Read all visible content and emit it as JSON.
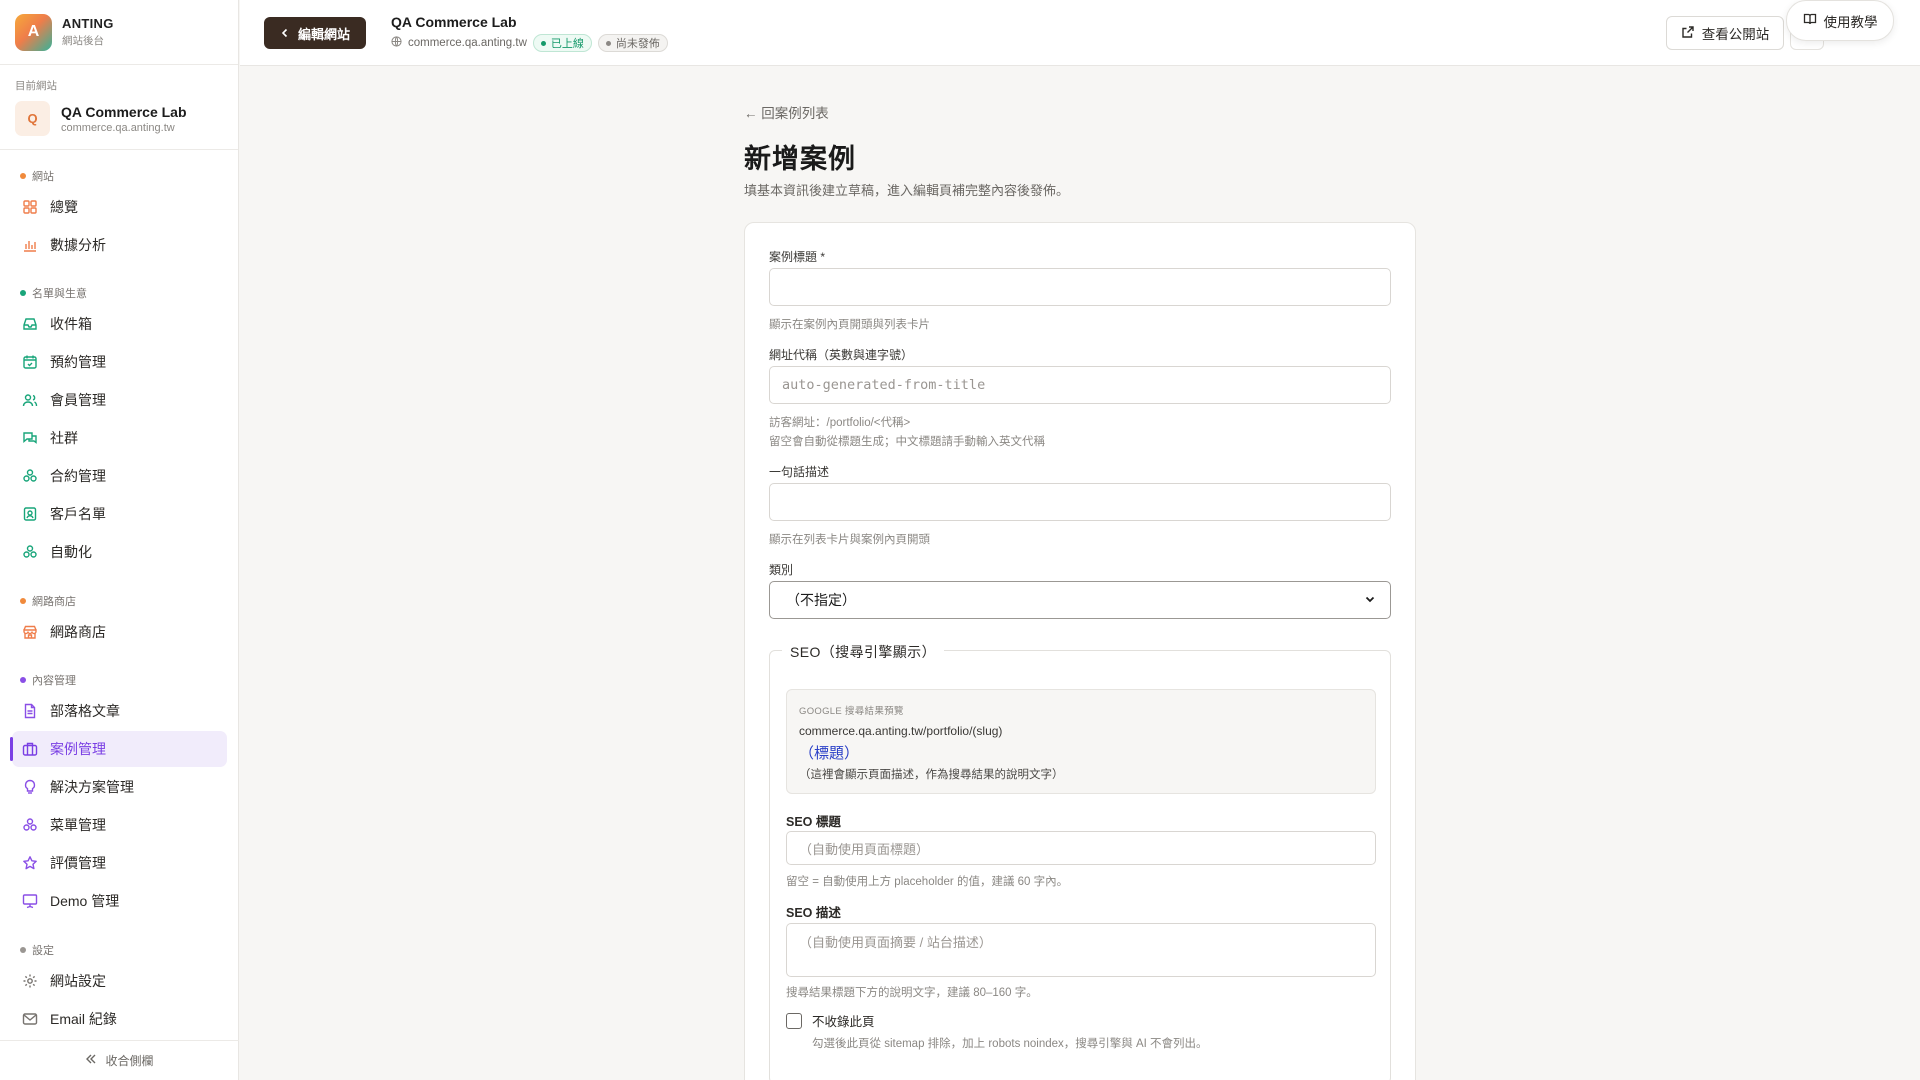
{
  "brand": {
    "logo_letter": "A",
    "name": "ANTING",
    "subtitle": "網站後台"
  },
  "current_site": {
    "caption": "目前網站",
    "avatar_letter": "Q",
    "name": "QA Commerce Lab",
    "domain": "commerce.qa.anting.tw"
  },
  "sidebar": {
    "sections": [
      {
        "title": "網站",
        "color": "#f08a3c"
      },
      {
        "title": "名單與生意",
        "color": "#19a57a"
      },
      {
        "title": "網路商店",
        "color": "#f08a3c"
      },
      {
        "title": "內容管理",
        "color": "#8a4fe6"
      },
      {
        "title": "設定",
        "color": "#9a9692"
      }
    ],
    "items": [
      {
        "label": "總覽",
        "icon": "grid-icon"
      },
      {
        "label": "數據分析",
        "icon": "bar-chart-icon"
      },
      {
        "label": "收件箱",
        "icon": "inbox-icon"
      },
      {
        "label": "預約管理",
        "icon": "calendar-icon"
      },
      {
        "label": "會員管理",
        "icon": "users-icon"
      },
      {
        "label": "社群",
        "icon": "chat-icon"
      },
      {
        "label": "合約管理",
        "icon": "cluster-icon"
      },
      {
        "label": "客戶名單",
        "icon": "contact-icon"
      },
      {
        "label": "自動化",
        "icon": "cluster-icon"
      },
      {
        "label": "網路商店",
        "icon": "store-icon"
      },
      {
        "label": "部落格文章",
        "icon": "document-icon"
      },
      {
        "label": "案例管理",
        "icon": "briefcase-icon"
      },
      {
        "label": "解決方案管理",
        "icon": "lightbulb-icon"
      },
      {
        "label": "菜單管理",
        "icon": "cluster-icon"
      },
      {
        "label": "評價管理",
        "icon": "star-icon"
      },
      {
        "label": "Demo 管理",
        "icon": "presentation-icon"
      },
      {
        "label": "網站設定",
        "icon": "gear-icon"
      },
      {
        "label": "Email 紀錄",
        "icon": "mail-icon"
      }
    ],
    "collapse_label": "收合側欄"
  },
  "topbar": {
    "back_button": "編輯網站",
    "site_title": "QA Commerce Lab",
    "site_domain": "commerce.qa.anting.tw",
    "status_live": "已上線",
    "status_draft": "尚未發佈",
    "public_button": "查看公開站",
    "tutorial_button": "使用教學"
  },
  "main": {
    "back_link": "← 回案例列表",
    "title": "新增案例",
    "description": "填基本資訊後建立草稿，進入編輯頁補完整內容後發佈。"
  },
  "form": {
    "title_label": "案例標題 *",
    "title_value": "",
    "title_hint": "顯示在案例內頁開頭與列表卡片",
    "slug_label": "網址代稱（英數與連字號）",
    "slug_placeholder": "auto-generated-from-title",
    "slug_hint_1": "訪客網址：/portfolio/<代稱>",
    "slug_hint_2": "留空會自動從標題生成；中文標題請手動輸入英文代稱",
    "summary_label": "一句話描述",
    "summary_value": "",
    "summary_hint": "顯示在列表卡片與案例內頁開頭",
    "category_label": "類別",
    "category_value": "（不指定）",
    "seo": {
      "legend": "SEO（搜尋引擎顯示）",
      "preview_caption": "GOOGLE 搜尋結果預覽",
      "preview_url": "commerce.qa.anting.tw/portfolio/(slug)",
      "preview_title": "（標題）",
      "preview_desc": "（這裡會顯示頁面描述，作為搜尋結果的說明文字）",
      "title_label": "SEO 標題",
      "title_placeholder": "（自動使用頁面標題）",
      "title_hint": "留空 = 自動使用上方 placeholder 的值，建議 60 字內。",
      "desc_label": "SEO 描述",
      "desc_placeholder": "（自動使用頁面摘要 / 站台描述）",
      "desc_hint": "搜尋結果標題下方的說明文字，建議 80–160 字。",
      "noindex_label": "不收錄此頁",
      "noindex_hint": "勾選後此頁從 sitemap 排除，加上 robots noindex，搜尋引擎與 AI 不會列出。",
      "noindex_checked": false
    }
  },
  "colors": {
    "accent": "#7a3fe4",
    "primary_button": "#3a2b22",
    "live": "#15996a",
    "link": "#2a3fc7"
  }
}
